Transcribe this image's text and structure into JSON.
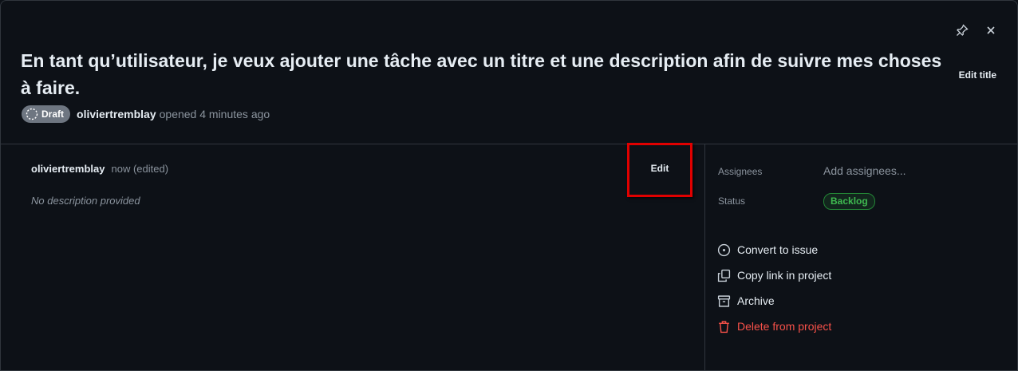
{
  "header": {
    "title": "En tant qu’utilisateur, je veux ajouter une tâche avec un titre et une description afin de suivre mes choses à faire.",
    "edit_title_label": "Edit title",
    "pin_icon": "pin-icon",
    "close_icon": "close-icon"
  },
  "meta": {
    "badge_label": "Draft",
    "author": "oliviertremblay",
    "opened_text": "opened 4 minutes ago"
  },
  "comment": {
    "author": "oliviertremblay",
    "time": "now (edited)",
    "edit_label": "Edit",
    "body": "No description provided"
  },
  "sidebar": {
    "assignees_label": "Assignees",
    "assignees_value": "Add assignees...",
    "status_label": "Status",
    "status_value": "Backlog",
    "status_color": "#3fb950",
    "actions": [
      {
        "label": "Convert to issue",
        "icon": "issue-circle-icon"
      },
      {
        "label": "Copy link in project",
        "icon": "copy-icon"
      },
      {
        "label": "Archive",
        "icon": "archive-icon"
      },
      {
        "label": "Delete from project",
        "icon": "trash-icon"
      }
    ]
  },
  "highlight_color": "#e00000",
  "danger_color": "#f85149"
}
